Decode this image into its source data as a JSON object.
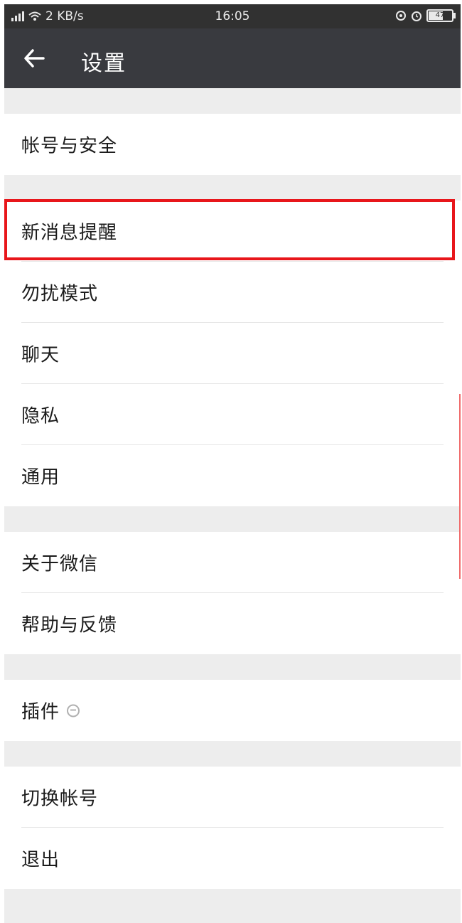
{
  "status_bar": {
    "network_speed": "2 KB/s",
    "time": "16:05",
    "battery": "47"
  },
  "header": {
    "title": "设置"
  },
  "settings": {
    "account_security": "帐号与安全",
    "new_message_alerts": "新消息提醒",
    "do_not_disturb": "勿扰模式",
    "chat": "聊天",
    "privacy": "隐私",
    "general": "通用",
    "about_wechat": "关于微信",
    "help_feedback": "帮助与反馈",
    "plugins": "插件",
    "switch_account": "切换帐号",
    "logout": "退出"
  },
  "colors": {
    "title_bar": "#393a3f",
    "status_bar": "#313131",
    "highlight": "#e8161b",
    "background": "#ededed"
  }
}
